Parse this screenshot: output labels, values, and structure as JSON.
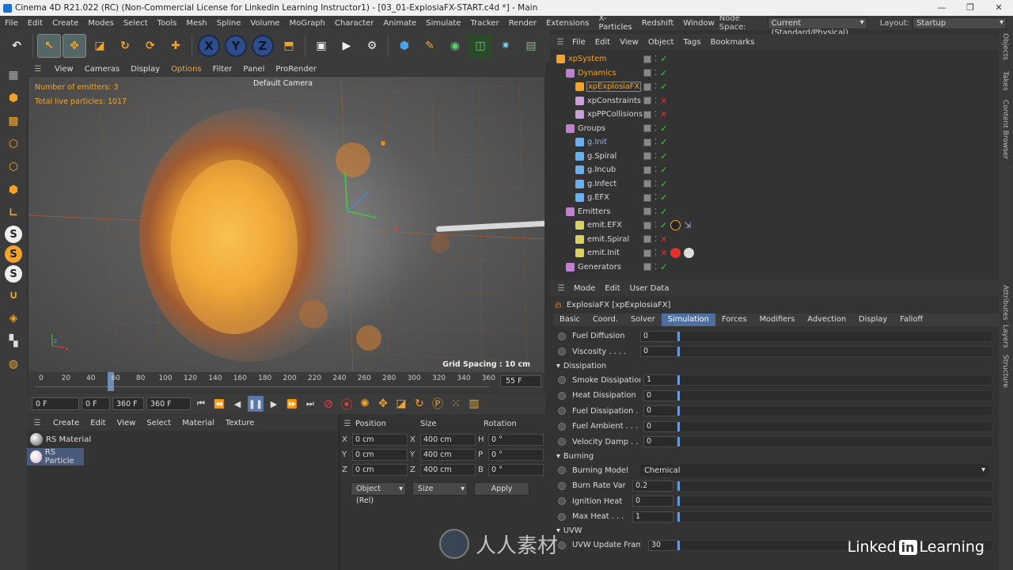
{
  "window": {
    "title": "Cinema 4D R21.022 (RC) (Non-Commercial License for Linkedin Learning Instructor1) - [03_01-ExplosiaFX-START.c4d *] - Main"
  },
  "menubar": {
    "items": [
      "File",
      "Edit",
      "Create",
      "Modes",
      "Select",
      "Tools",
      "Mesh",
      "Spline",
      "Volume",
      "MoGraph",
      "Character",
      "Animate",
      "Simulate",
      "Tracker",
      "Render",
      "Extensions",
      "X-Particles",
      "Redshift",
      "Window"
    ],
    "node_space_label": "Node Space:",
    "node_space_value": "Current (Standard/Physical)",
    "layout_label": "Layout:",
    "layout_value": "Startup"
  },
  "viewport": {
    "menu": [
      "View",
      "Cameras",
      "Display",
      "Options",
      "Filter",
      "Panel",
      "ProRender"
    ],
    "hud_emitters": "Number of emitters: 3",
    "hud_particles": "Total live particles: 1017",
    "camera": "Default Camera",
    "grid_spacing": "Grid Spacing : 10 cm"
  },
  "timeline": {
    "ticks": [
      "0",
      "20",
      "40",
      "60",
      "80",
      "100",
      "120",
      "140",
      "160",
      "180",
      "200",
      "220",
      "240",
      "260",
      "280",
      "300",
      "320",
      "340",
      "360"
    ],
    "end_field": "55 F",
    "current_frame_fraction": 0.155
  },
  "transport": {
    "start": "0 F",
    "range_start": "0 F",
    "range_end": "360 F",
    "end": "360 F"
  },
  "materials": {
    "menu": [
      "Create",
      "Edit",
      "View",
      "Select",
      "Material",
      "Texture"
    ],
    "items": [
      {
        "name": "RS Material",
        "color": "#5a5a5a"
      },
      {
        "name": "RS Particle",
        "color": "#d8b8c8"
      }
    ]
  },
  "coords": {
    "headers": [
      "Position",
      "Size",
      "Rotation"
    ],
    "rows": [
      {
        "axis": "X",
        "pos": "0 cm",
        "size_axis": "X",
        "size": "400 cm",
        "rot_axis": "H",
        "rot": "0 °"
      },
      {
        "axis": "Y",
        "pos": "0 cm",
        "size_axis": "Y",
        "size": "400 cm",
        "rot_axis": "P",
        "rot": "0 °"
      },
      {
        "axis": "Z",
        "pos": "0 cm",
        "size_axis": "Z",
        "size": "400 cm",
        "rot_axis": "B",
        "rot": "0 °"
      }
    ],
    "mode": "Object (Rel)",
    "size_mode": "Size",
    "apply": "Apply"
  },
  "objects": {
    "menu": [
      "File",
      "Edit",
      "View",
      "Object",
      "Tags",
      "Bookmarks"
    ],
    "items": [
      {
        "name": "xpSystem",
        "indent": 0,
        "color": "#f2a32a",
        "icon": "system-icon",
        "status": "check"
      },
      {
        "name": "Dynamics",
        "indent": 1,
        "color": "#f2a32a",
        "icon": "folder-icon",
        "status": "check"
      },
      {
        "name": "xpExplosiaFX",
        "indent": 2,
        "color": "#f2a32a",
        "icon": "flame-icon",
        "status": "check",
        "selected": true
      },
      {
        "name": "xpConstraints",
        "indent": 2,
        "color": "#d8d8d8",
        "icon": "constraint-icon",
        "status": "cross"
      },
      {
        "name": "xpPPCollisions",
        "indent": 2,
        "color": "#d8d8d8",
        "icon": "collision-icon",
        "status": "cross"
      },
      {
        "name": "Groups",
        "indent": 1,
        "color": "#d8d8d8",
        "icon": "folder-icon",
        "status": "check"
      },
      {
        "name": "g.Init",
        "indent": 2,
        "color": "#8ab4f0",
        "icon": "group-icon",
        "status": "check"
      },
      {
        "name": "g.Spiral",
        "indent": 2,
        "color": "#d8d8d8",
        "icon": "group-icon",
        "status": "check"
      },
      {
        "name": "g.Incub",
        "indent": 2,
        "color": "#d8d8d8",
        "icon": "group-icon",
        "status": "check"
      },
      {
        "name": "g.Infect",
        "indent": 2,
        "color": "#d8d8d8",
        "icon": "group-icon",
        "status": "check"
      },
      {
        "name": "g.EFX",
        "indent": 2,
        "color": "#d8d8d8",
        "icon": "group-icon",
        "status": "check"
      },
      {
        "name": "Emitters",
        "indent": 1,
        "color": "#d8d8d8",
        "icon": "folder-icon",
        "status": "check"
      },
      {
        "name": "emit.EFX",
        "indent": 2,
        "color": "#d8d8d8",
        "icon": "emitter-icon",
        "status": "check",
        "tags": [
          "flame-tag-icon",
          "cursor-tag-icon"
        ]
      },
      {
        "name": "emit.Spiral",
        "indent": 2,
        "color": "#d8d8d8",
        "icon": "emitter-icon",
        "status": "cross"
      },
      {
        "name": "emit.Init",
        "indent": 2,
        "color": "#d8d8d8",
        "icon": "emitter-icon",
        "status": "cross",
        "tags": [
          "red-material-tag-icon",
          "white-material-tag-icon"
        ]
      },
      {
        "name": "Generators",
        "indent": 1,
        "color": "#d8d8d8",
        "icon": "folder-icon",
        "status": "check"
      }
    ]
  },
  "attributes": {
    "menu": [
      "Mode",
      "Edit",
      "User Data"
    ],
    "object_name": "ExplosiaFX [xpExplosiaFX]",
    "tabs": [
      "Basic",
      "Coord.",
      "Solver",
      "Simulation",
      "Forces",
      "Modifiers",
      "Advection",
      "Display",
      "Falloff"
    ],
    "active_tab": "Simulation",
    "top_rows": [
      {
        "label": "Fuel Diffusion",
        "value": "0"
      },
      {
        "label": "Viscosity . . . .",
        "value": "0"
      }
    ],
    "dissipation_title": "Dissipation",
    "dissipation": [
      {
        "label": "Smoke Dissipation",
        "value": "1"
      },
      {
        "label": "Heat Dissipation",
        "value": "0"
      },
      {
        "label": "Fuel Dissipation .",
        "value": "0"
      },
      {
        "label": "Fuel Ambient . . .",
        "value": "0"
      },
      {
        "label": "Velocity Damp . .",
        "value": "0"
      }
    ],
    "burning_title": "Burning",
    "burning_model_label": "Burning Model",
    "burning_model_value": "Chemical",
    "burning": [
      {
        "label": "Burn Rate Var",
        "value": "0.2"
      },
      {
        "label": "Ignition Heat",
        "value": "0"
      },
      {
        "label": "Max Heat . . .",
        "value": "1"
      }
    ],
    "uvw_title": "UVW",
    "uvw": [
      {
        "label": "UVW Update Frames",
        "value": "30"
      }
    ]
  },
  "sidebar_tabs": {
    "top": [
      "Objects",
      "Takes",
      "Content Browser"
    ],
    "bottom": [
      "Attributes",
      "Layers",
      "Structure"
    ]
  },
  "branding": {
    "linkedin_left": "Linked",
    "linkedin_in": "in",
    "linkedin_right": "Learning",
    "watermark_text": "人人素材"
  }
}
